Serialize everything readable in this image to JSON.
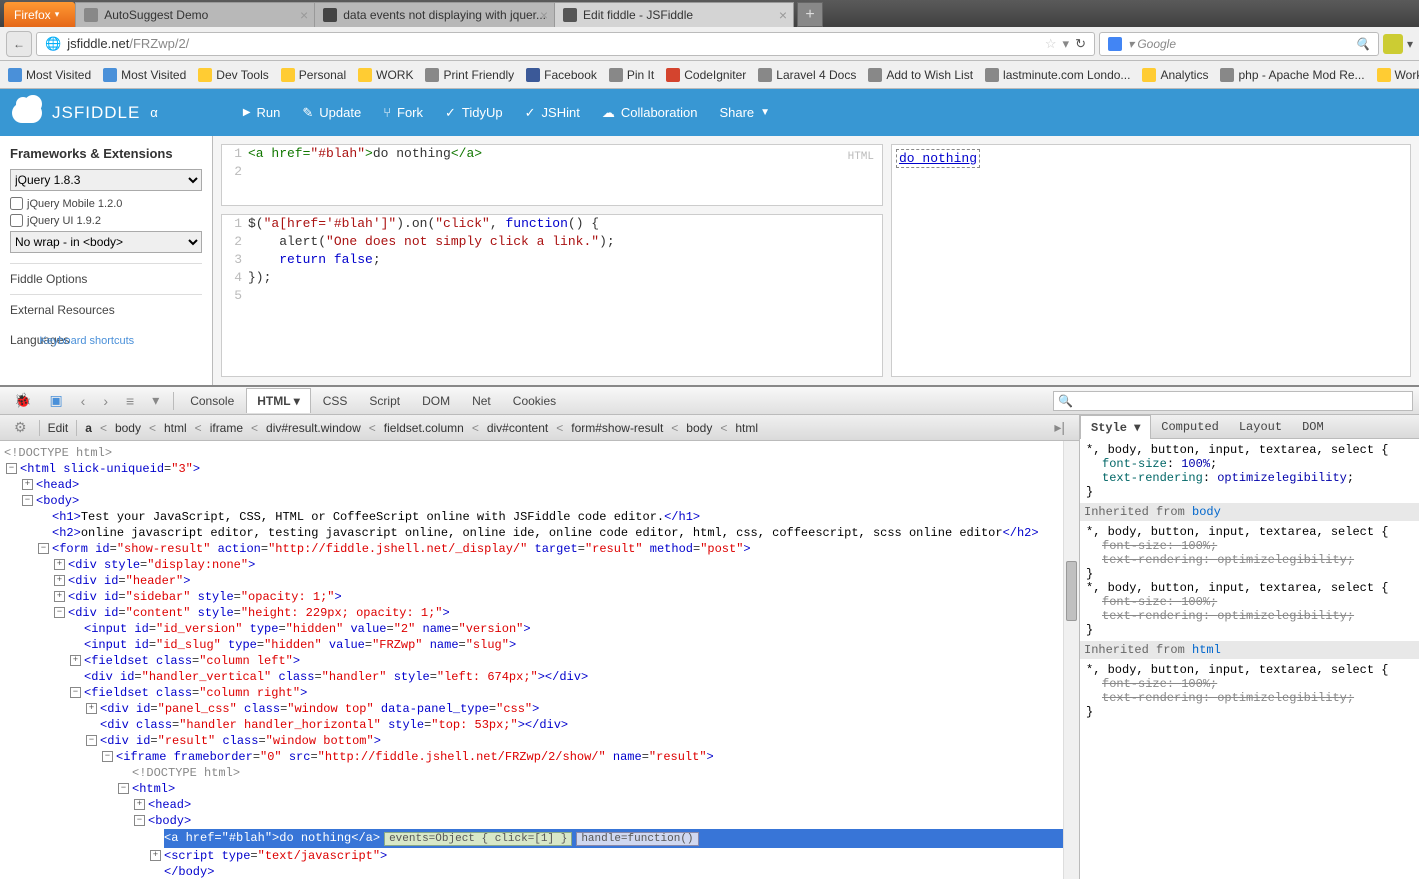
{
  "browser": {
    "firefox": "Firefox",
    "tabs": [
      {
        "title": "AutoSuggest Demo"
      },
      {
        "title": "data events not displaying with jquer..."
      },
      {
        "title": "Edit fiddle - JSFiddle"
      }
    ],
    "url_host": "jsfiddle.net",
    "url_path": "/FRZwp/2/",
    "search_placeholder": "Google",
    "bookmarks": [
      "Most Visited",
      "Most Visited",
      "Dev Tools",
      "Personal",
      "WORK",
      "Print Friendly",
      "Facebook",
      "Pin It",
      "CodeIgniter",
      "Laravel 4 Docs",
      "Add to Wish List",
      "lastminute.com Londo...",
      "Analytics",
      "php - Apache Mod Re...",
      "Work"
    ]
  },
  "jsfiddle": {
    "brand": "JSFIDDLE",
    "brand_suffix": "α",
    "actions": [
      "Run",
      "Update",
      "Fork",
      "TidyUp",
      "JSHint",
      "Collaboration",
      "Share"
    ],
    "sidebar": {
      "frameworks_title": "Frameworks & Extensions",
      "framework_select": "jQuery 1.8.3",
      "ext1": "jQuery Mobile 1.2.0",
      "ext2": "jQuery UI 1.9.2",
      "wrap_select": "No wrap - in <body>",
      "fiddle_options": "Fiddle Options",
      "external": "External Resources",
      "languages": "Languages",
      "kbd": "Keyboard shortcuts"
    },
    "html_panel_label": "HTML",
    "html_code": {
      "l1_open": "<a ",
      "l1_attr": "href=",
      "l1_val": "\"#blah\"",
      "l1_close": ">",
      "l1_text": "do nothing",
      "l1_end": "</a>"
    },
    "js_code": {
      "l1": "$(\"a[href='#blah']\").on(\"click\", function() {",
      "l2a": "    alert(",
      "l2b": "\"One does not simply click a link.\"",
      "l2c": ");",
      "l3": "    return false;",
      "l4": "});"
    },
    "result_text": "do nothing"
  },
  "firebug": {
    "tabs": [
      "Console",
      "HTML",
      "CSS",
      "Script",
      "DOM",
      "Net",
      "Cookies"
    ],
    "active_tab": 1,
    "subbar": {
      "edit": "Edit",
      "crumbs": [
        "a",
        "body",
        "html",
        "iframe",
        "div#result.window",
        "fieldset.column",
        "div#content",
        "form#show-result",
        "body",
        "html"
      ]
    },
    "html": {
      "doctype": "<!DOCTYPE html>",
      "html_open": "<html slick-uniqueid=\"3\">",
      "head": "<head>",
      "body": "<body>",
      "h1": "Test your JavaScript, CSS, HTML or CoffeeScript online with JSFiddle code editor.",
      "h2": "online javascript editor, testing javascript online, online ide, online code editor, html, css, coffeescript, scss online editor",
      "form": "<form id=\"show-result\" action=\"http://fiddle.jshell.net/_display/\" target=\"result\" method=\"post\">",
      "div_hidden": "<div style=\"display:none\">",
      "div_header": "<div id=\"header\">",
      "div_sidebar": "<div id=\"sidebar\" style=\"opacity: 1;\">",
      "div_content": "<div id=\"content\" style=\"height: 229px; opacity: 1;\">",
      "input_ver": "<input id=\"id_version\" type=\"hidden\" value=\"2\" name=\"version\">",
      "input_slug": "<input id=\"id_slug\" type=\"hidden\" value=\"FRZwp\" name=\"slug\">",
      "fs_left": "<fieldset class=\"column left\">",
      "handler_v": "<div id=\"handler_vertical\" class=\"handler\" style=\"left: 674px;\"></div>",
      "fs_right": "<fieldset class=\"column right\">",
      "panel_css": "<div id=\"panel_css\" class=\"window top\" data-panel_type=\"css\">",
      "handler_h": "<div class=\"handler handler_horizontal\" style=\"top: 53px;\"></div>",
      "div_result": "<div id=\"result\" class=\"window bottom\">",
      "iframe": "<iframe frameborder=\"0\" src=\"http://fiddle.jshell.net/FRZwp/2/show/\" name=\"result\">",
      "doctype2": "<!DOCTYPE html>",
      "html2": "<html>",
      "head2": "<head>",
      "body2": "<body>",
      "anchor": "<a href=\"#blah\">do nothing</a>",
      "ev_label": "events=Object { click=[1] }",
      "hn_label": "handle=function()",
      "script": "<script type=\"text/javascript\">",
      "body2_close": "</body>"
    },
    "style_tabs": [
      "Style",
      "Computed",
      "Layout",
      "DOM"
    ],
    "css": {
      "sel": "*, body, button, input, textarea, select {",
      "p1": "font-size",
      "v1": "100%",
      "p2": "text-rendering",
      "v2": "optimizelegibility",
      "inh_body": "Inherited from body",
      "inh_html": "Inherited from html"
    }
  }
}
